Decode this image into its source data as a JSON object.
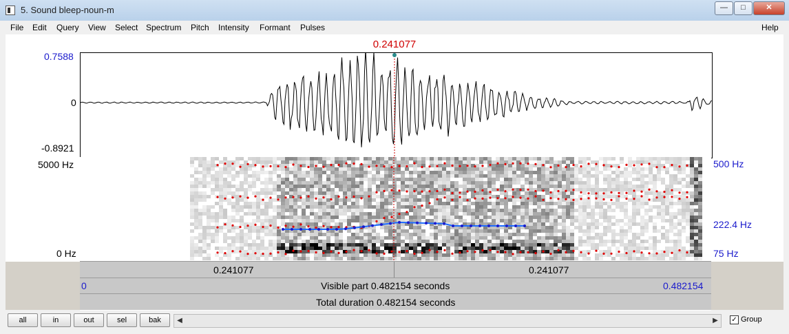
{
  "window": {
    "title": "5. Sound bleep-noun-m"
  },
  "menu": [
    "File",
    "Edit",
    "Query",
    "View",
    "Select",
    "Spectrum",
    "Pitch",
    "Intensity",
    "Formant",
    "Pulses"
  ],
  "help": "Help",
  "cursor_time": "0.241077",
  "waveform": {
    "top": "0.7588",
    "zero": "0",
    "bottom": "-0.8921"
  },
  "spectrogram": {
    "freq_top": "5000 Hz",
    "freq_bottom": "0 Hz",
    "pitch_top": "500 Hz",
    "pitch_mid": "222.4 Hz",
    "pitch_bottom": "75 Hz"
  },
  "selection_bar": {
    "left": "0.241077",
    "right": "0.241077"
  },
  "visible_bar": {
    "start": "0",
    "label": "Visible part 0.482154 seconds",
    "end": "0.482154"
  },
  "total_bar": {
    "label": "Total duration 0.482154 seconds"
  },
  "buttons": [
    "all",
    "in",
    "out",
    "sel",
    "bak"
  ],
  "group": {
    "label": "Group",
    "checked": true
  }
}
